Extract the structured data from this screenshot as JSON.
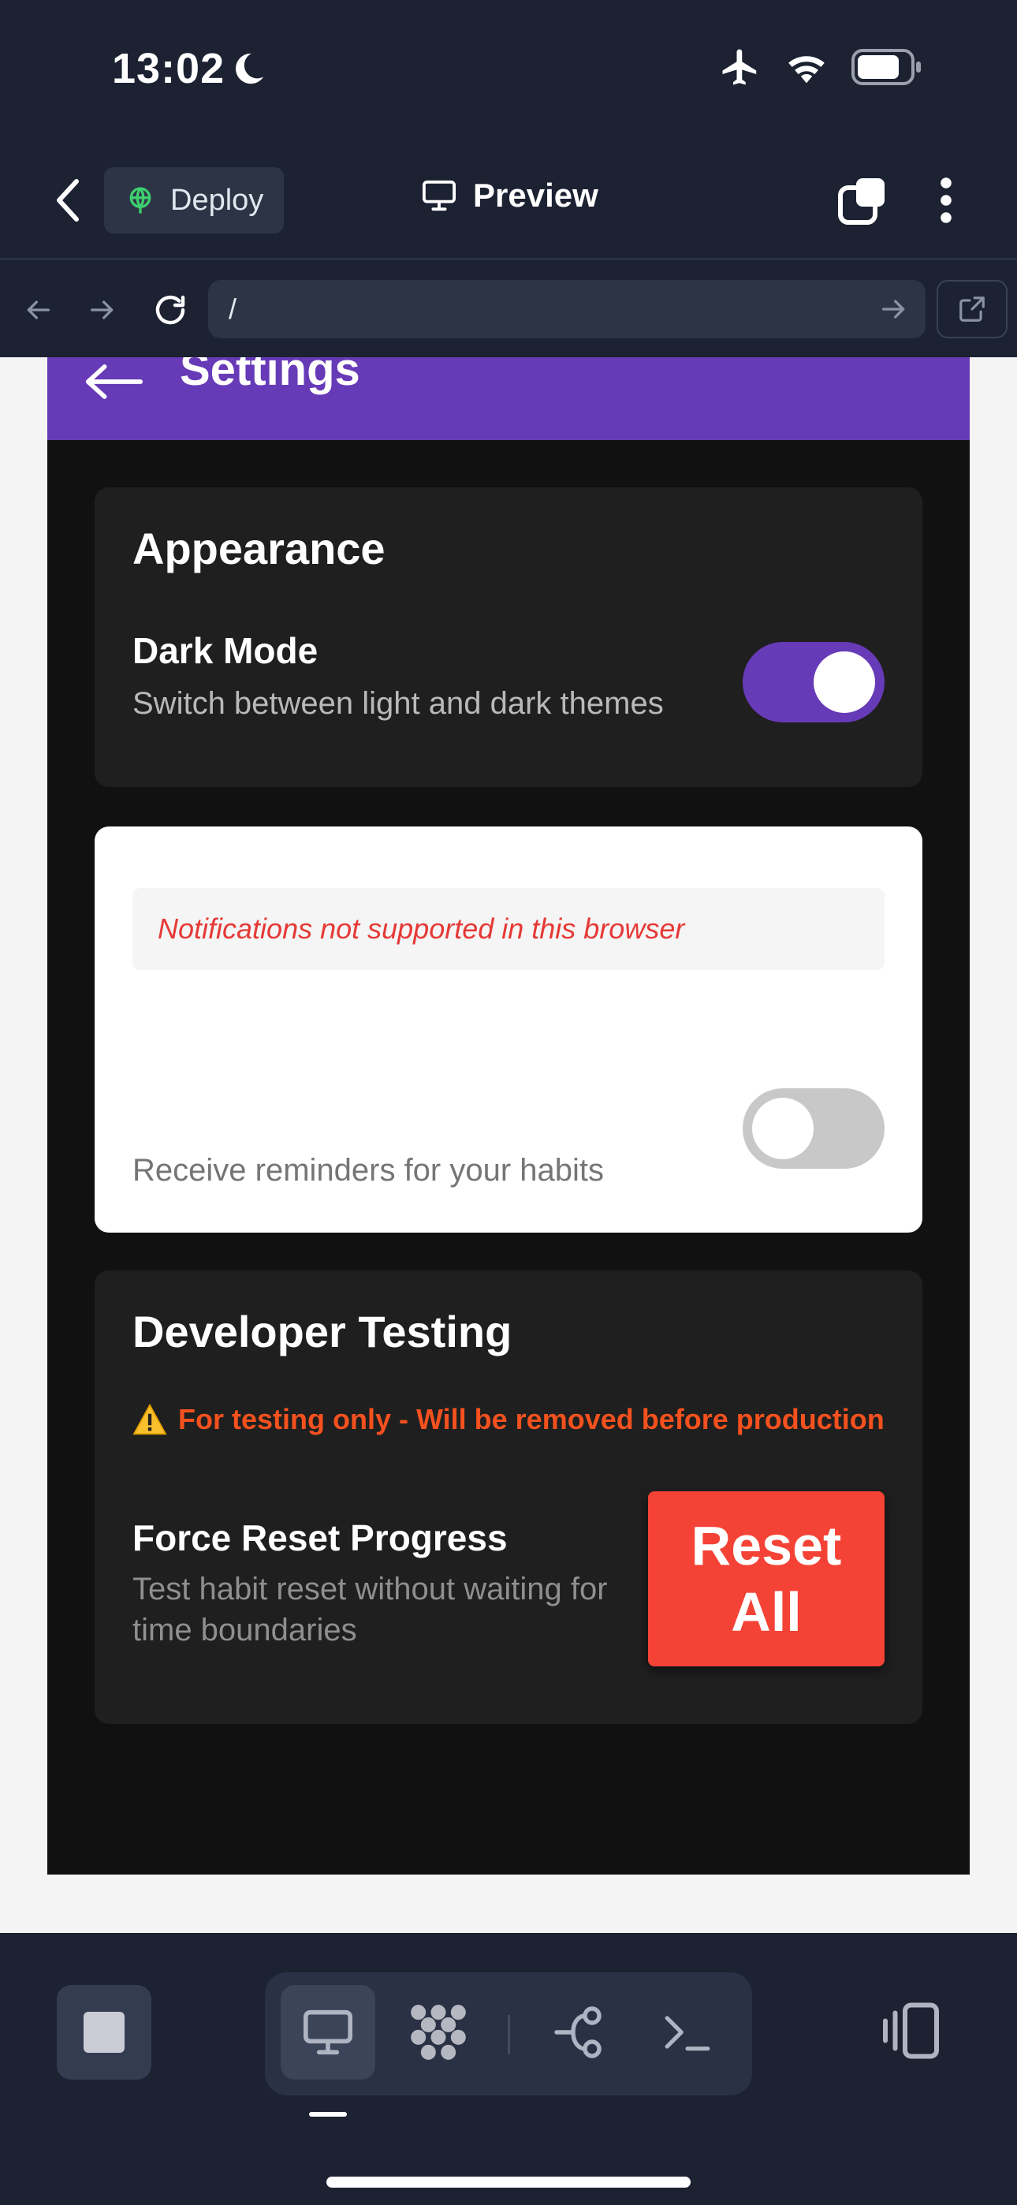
{
  "status_bar": {
    "time": "13:02",
    "icons": [
      "moon-icon",
      "airplane-icon",
      "wifi-icon",
      "battery-icon"
    ]
  },
  "header": {
    "deploy_label": "Deploy",
    "preview_label": "Preview"
  },
  "browser": {
    "url": "/"
  },
  "app": {
    "title": "Settings",
    "accent_color": "#673ab7",
    "appearance": {
      "heading": "Appearance",
      "dark_mode_title": "Dark Mode",
      "dark_mode_desc": "Switch between light and dark themes",
      "dark_mode_on": true
    },
    "notifications": {
      "notice": "Notifications not supported in this browser",
      "desc": "Receive reminders for your habits",
      "enabled": false
    },
    "developer": {
      "heading": "Developer Testing",
      "warning": "For testing only - Will be removed before production",
      "reset_title": "Force Reset Progress",
      "reset_desc": "Test habit reset without waiting for time boundaries",
      "reset_button": "Reset All",
      "reset_color": "#f44336"
    }
  },
  "toolbar": {
    "items": [
      "monitor-icon",
      "dots-grid-icon",
      "branch-icon",
      "terminal-icon"
    ]
  }
}
